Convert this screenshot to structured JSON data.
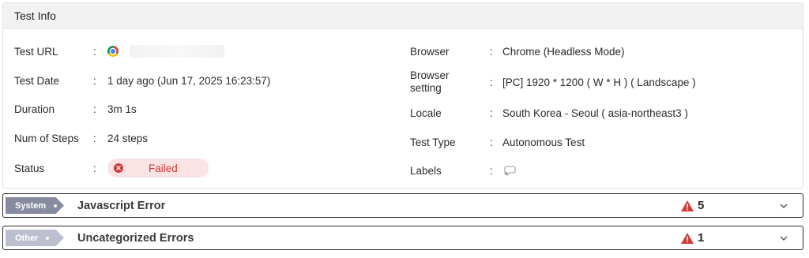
{
  "panel": {
    "title": "Test Info",
    "left": [
      {
        "label": "Test URL",
        "colon": ":",
        "value": ""
      },
      {
        "label": "Test Date",
        "colon": ":",
        "value": "1 day ago (Jun 17, 2025 16:23:57)"
      },
      {
        "label": "Duration",
        "colon": ":",
        "value": "3m 1s"
      },
      {
        "label": "Num of Steps",
        "colon": ":",
        "value": "24 steps"
      },
      {
        "label": "Status",
        "colon": ":",
        "value": "Failed"
      }
    ],
    "right": [
      {
        "label": "Browser",
        "colon": ":",
        "value": "Chrome (Headless Mode)"
      },
      {
        "label_line1": "Browser",
        "label_line2": "setting",
        "colon": ":",
        "value": "[PC] 1920 * 1200 ( W * H ) ( Landscape )"
      },
      {
        "label": "Locale",
        "colon": ":",
        "value": "South Korea - Seoul  ( asia-northeast3 )"
      },
      {
        "label": "Test Type",
        "colon": ":",
        "value": "Autonomous Test"
      },
      {
        "label": "Labels",
        "colon": ":",
        "value": ""
      }
    ]
  },
  "errors": [
    {
      "category": "System",
      "title": "Javascript Error",
      "count": "5"
    },
    {
      "category": "Other",
      "title": "Uncategorized Errors",
      "count": "1"
    }
  ],
  "colors": {
    "failed": "#d23a3a",
    "failed_bg": "#fbe3e3",
    "system_chip": "#878ba0",
    "other_chip": "#bcc0ce",
    "warning": "#d23a3a"
  },
  "icons": {
    "browser": "chrome-icon",
    "status": "error-circle-icon",
    "labels": "add-label-icon",
    "warning": "warning-triangle-icon",
    "expand": "chevron-down-icon"
  }
}
